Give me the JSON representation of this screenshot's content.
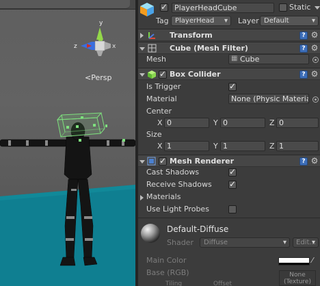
{
  "scene": {
    "projection_label": "Persp",
    "axes": {
      "x": "x",
      "y": "y",
      "z": "z"
    }
  },
  "inspector": {
    "object": {
      "name": "PlayerHeadCube",
      "active": true,
      "static_label": "Static",
      "static": false
    },
    "tag": {
      "label": "Tag",
      "value": "PlayerHead"
    },
    "layer": {
      "label": "Layer",
      "value": "Default"
    },
    "transform": {
      "title": "Transform"
    },
    "mesh_filter": {
      "title": "Cube (Mesh Filter)",
      "mesh_label": "Mesh",
      "mesh_value": "Cube"
    },
    "box_collider": {
      "title": "Box Collider",
      "enabled": true,
      "is_trigger_label": "Is Trigger",
      "is_trigger": true,
      "material_label": "Material",
      "material_value": "None (Physic Material",
      "center_label": "Center",
      "center": {
        "x": "0",
        "y": "0",
        "z": "0"
      },
      "size_label": "Size",
      "size": {
        "x": "1",
        "y": "1",
        "z": "1"
      }
    },
    "mesh_renderer": {
      "title": "Mesh Renderer",
      "enabled": true,
      "cast_shadows_label": "Cast Shadows",
      "cast_shadows": true,
      "receive_shadows_label": "Receive Shadows",
      "receive_shadows": true,
      "materials_label": "Materials",
      "light_probes_label": "Use Light Probes",
      "light_probes": false
    },
    "material": {
      "name": "Default-Diffuse",
      "shader_label": "Shader",
      "shader_value": "Diffuse",
      "edit_label": "Edit...",
      "main_color_label": "Main Color",
      "main_color": "#ffffff",
      "base_label": "Base (RGB)",
      "texture_none": "None",
      "texture_type": "(Texture)",
      "tiling_label": "Tiling",
      "offset_label": "Offset"
    },
    "axis_labels": {
      "x": "X",
      "y": "Y",
      "z": "Z"
    }
  },
  "colors": {
    "ground": "#0f7f91",
    "collider": "#7ee07e",
    "axis_x": "#d03020",
    "axis_y": "#94d84a",
    "axis_z": "#3a6ee0"
  }
}
